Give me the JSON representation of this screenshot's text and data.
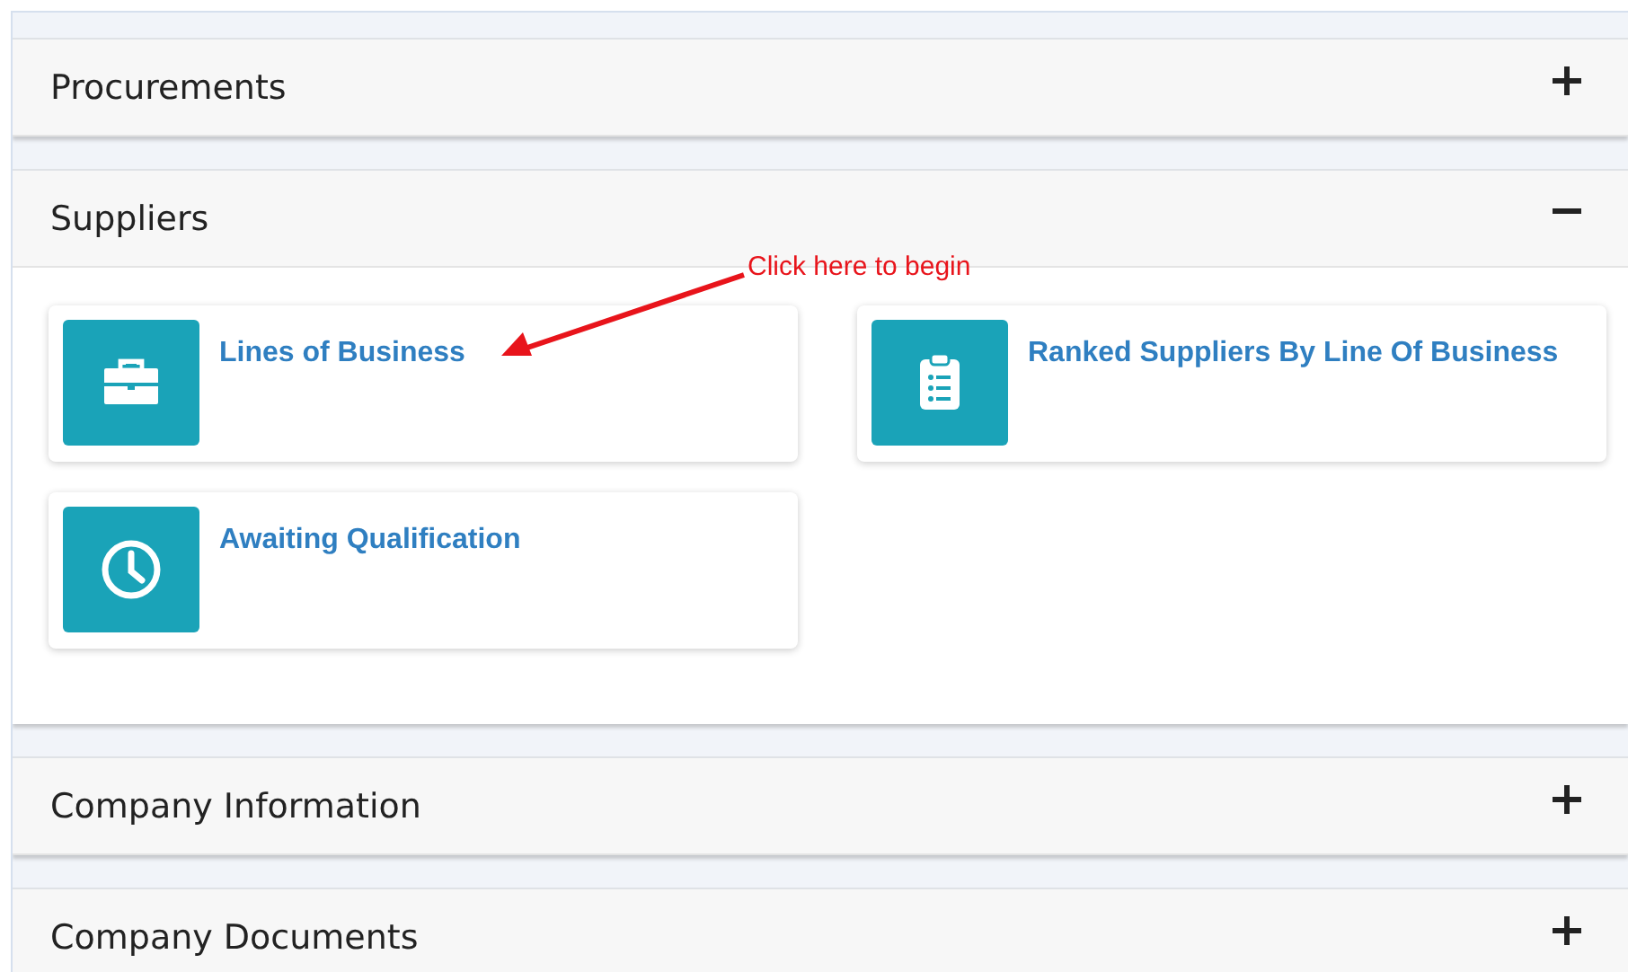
{
  "sections": [
    {
      "title": "Procurements",
      "expanded": false
    },
    {
      "title": "Suppliers",
      "expanded": true,
      "tiles": [
        {
          "label": "Lines of Business",
          "kind": "briefcase"
        },
        {
          "label": "Ranked Suppliers By Line Of Business",
          "kind": "clipboard"
        },
        {
          "label": "Awaiting Qualification",
          "kind": "clock"
        }
      ]
    },
    {
      "title": "Company Information",
      "expanded": false
    },
    {
      "title": "Company Documents",
      "expanded": false
    }
  ],
  "annotation": {
    "text": "Click here to begin"
  }
}
